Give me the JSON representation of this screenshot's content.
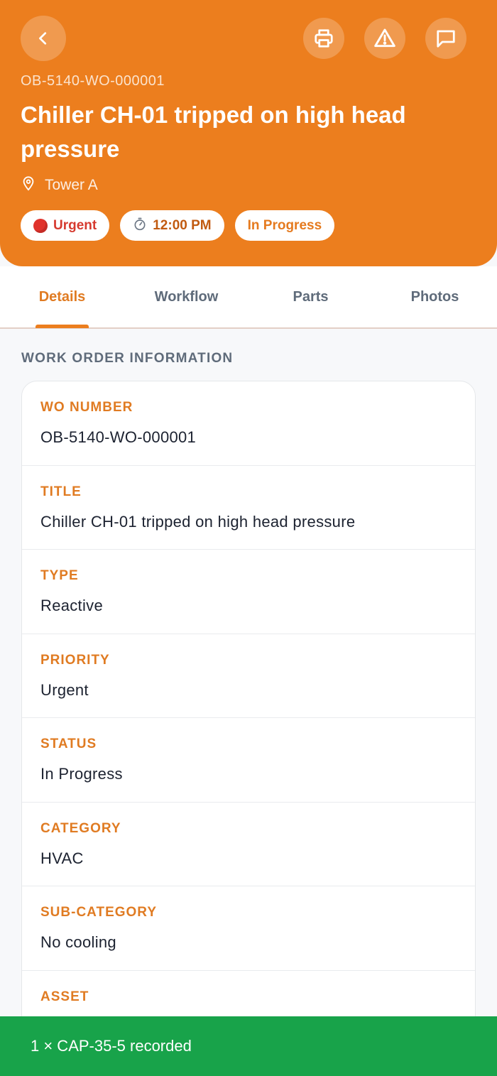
{
  "header": {
    "wo_code": "OB-5140-WO-000001",
    "title": "Chiller CH-01 tripped on high head pressure",
    "location": "Tower A",
    "pills": {
      "priority": "Urgent",
      "time": "12:00 PM",
      "status": "In Progress"
    },
    "icons": {
      "back": "chevron-left-icon",
      "print": "printer-icon",
      "alert": "warning-triangle-icon",
      "chat": "chat-bubble-icon",
      "location": "map-pin-icon",
      "priority": "red-circle-icon",
      "time": "stopwatch-icon"
    }
  },
  "tabs": [
    {
      "label": "Details",
      "active": true
    },
    {
      "label": "Workflow",
      "active": false
    },
    {
      "label": "Parts",
      "active": false
    },
    {
      "label": "Photos",
      "active": false
    }
  ],
  "section": {
    "title": "WORK ORDER INFORMATION",
    "fields": [
      {
        "label": "WO NUMBER",
        "value": "OB-5140-WO-000001"
      },
      {
        "label": "TITLE",
        "value": "Chiller CH-01 tripped on high head pressure"
      },
      {
        "label": "TYPE",
        "value": "Reactive"
      },
      {
        "label": "PRIORITY",
        "value": "Urgent"
      },
      {
        "label": "STATUS",
        "value": "In Progress"
      },
      {
        "label": "CATEGORY",
        "value": "HVAC"
      },
      {
        "label": "SUB-CATEGORY",
        "value": "No cooling"
      },
      {
        "label": "ASSET",
        "value": ""
      }
    ]
  },
  "toast": {
    "message": "1 × CAP-35-5 recorded"
  },
  "colors": {
    "accent": "#ec7e1e",
    "toast": "#18a34a",
    "urgent": "#d63a2f"
  }
}
